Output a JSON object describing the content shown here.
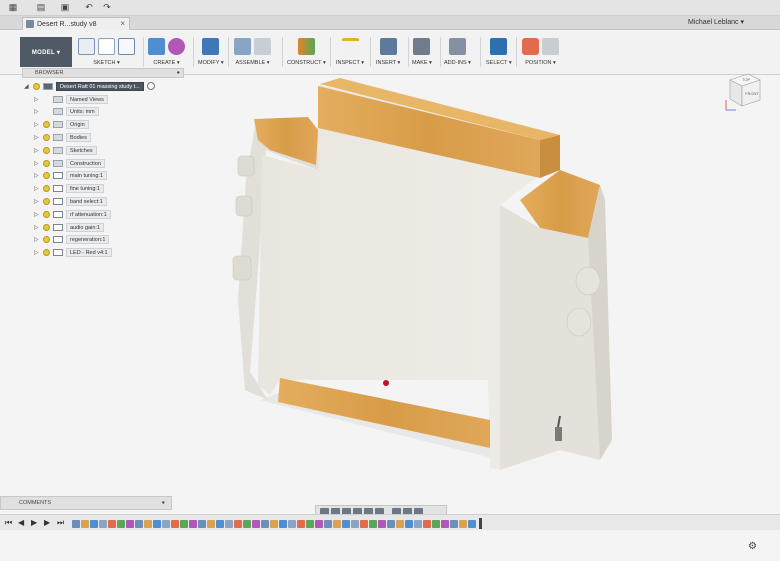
{
  "document": {
    "tab_title": "Desert R...study v8",
    "user_name": "Michael Leblanc ▾"
  },
  "toolbar": {
    "workspace": "MODEL ▾",
    "groups": [
      {
        "label": "SKETCH ▾"
      },
      {
        "label": "CREATE ▾"
      },
      {
        "label": "MODIFY ▾"
      },
      {
        "label": "ASSEMBLE ▾"
      },
      {
        "label": "CONSTRUCT ▾"
      },
      {
        "label": "INSPECT ▾"
      },
      {
        "label": "INSERT ▾"
      },
      {
        "label": "MAKE ▾"
      },
      {
        "label": "ADD-INS ▾"
      },
      {
        "label": "SELECT ▾"
      },
      {
        "label": "POSITION ▾"
      }
    ]
  },
  "viewcube": {
    "top": "TOP",
    "front": "FRONT"
  },
  "browser": {
    "title": "BROWSER",
    "root": "Desert Ratt 01 massing study t...",
    "items": [
      {
        "label": "Named Views",
        "kind": "folder",
        "bulb": false
      },
      {
        "label": "Units: mm",
        "kind": "file",
        "bulb": false
      },
      {
        "label": "Origin",
        "kind": "folder",
        "bulb": true
      },
      {
        "label": "Bodies",
        "kind": "folder",
        "bulb": true
      },
      {
        "label": "Sketches",
        "kind": "folder",
        "bulb": true
      },
      {
        "label": "Construction",
        "kind": "folder",
        "bulb": true
      },
      {
        "label": "main tuning:1",
        "kind": "component",
        "bulb": true
      },
      {
        "label": "fine tuning:1",
        "kind": "component",
        "bulb": true
      },
      {
        "label": "band select:1",
        "kind": "component",
        "bulb": true
      },
      {
        "label": "rf attenuation:1",
        "kind": "component",
        "bulb": true
      },
      {
        "label": "audio gain:1",
        "kind": "component",
        "bulb": true
      },
      {
        "label": "regeneration:1",
        "kind": "component",
        "bulb": true
      },
      {
        "label": "LED - Red v4:1",
        "kind": "component",
        "bulb": true
      }
    ]
  },
  "comments": {
    "title": "COMMENTS"
  },
  "colors": {
    "wood": "#d9a24e",
    "body": "#ebe8e2",
    "toolbar_dark": "#505a66",
    "led": "#c0151b"
  }
}
